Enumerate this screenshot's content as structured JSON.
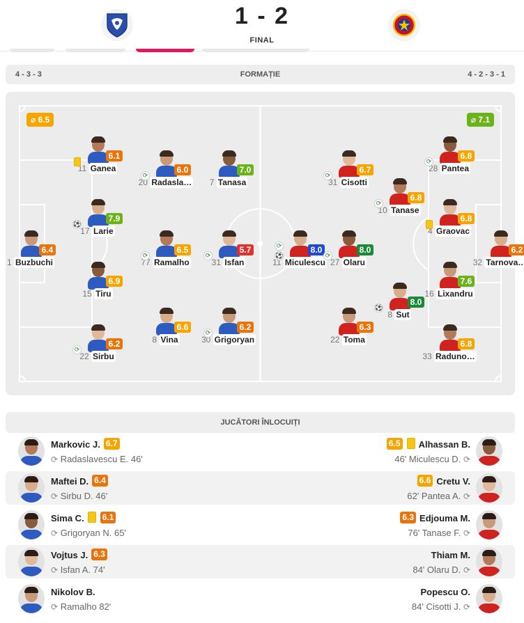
{
  "colors": {
    "rating_orange": "#e8750c",
    "rating_amber": "#f5a400",
    "rating_green": "#6cb21b",
    "rating_darkgreen": "#1a8a3a",
    "rating_red": "#e0322c",
    "rating_blue": "#1f4ad1",
    "home_shirt": "#2d5bbf",
    "away_shirt": "#d0231f"
  },
  "header": {
    "home_crest_icon": "farul-crest-icon",
    "away_crest_icon": "fcsb-crest-icon",
    "score": "1 - 2",
    "status": "FINAL"
  },
  "formation_bar": {
    "home_formation": "4 - 3 - 3",
    "title": "FORMAȚIE",
    "away_formation": "4 - 2 - 3 - 1"
  },
  "pitch": {
    "home_avg": "⌀ 6.5",
    "away_avg": "⌀ 7.1",
    "home_players": [
      {
        "no": "1",
        "name": "Buzbuchi",
        "rating": "6.4",
        "tier": "orange",
        "event": ""
      },
      {
        "no": "11",
        "name": "Ganea",
        "rating": "6.1",
        "tier": "orange",
        "event": "card"
      },
      {
        "no": "17",
        "name": "Larie",
        "rating": "7.9",
        "tier": "green",
        "event": "ball"
      },
      {
        "no": "15",
        "name": "Tiru",
        "rating": "6.9",
        "tier": "amber",
        "event": ""
      },
      {
        "no": "22",
        "name": "Sirbu",
        "rating": "6.2",
        "tier": "orange",
        "event": "sub"
      },
      {
        "no": "20",
        "name": "Radasla…",
        "rating": "6.0",
        "tier": "orange",
        "event": "sub"
      },
      {
        "no": "77",
        "name": "Ramalho",
        "rating": "6.5",
        "tier": "amber",
        "event": "sub"
      },
      {
        "no": "8",
        "name": "Vina",
        "rating": "6.6",
        "tier": "amber",
        "event": ""
      },
      {
        "no": "7",
        "name": "Tanasa",
        "rating": "7.0",
        "tier": "green",
        "event": ""
      },
      {
        "no": "31",
        "name": "Isfan",
        "rating": "5.7",
        "tier": "red",
        "event": "sub"
      },
      {
        "no": "30",
        "name": "Grigoryan",
        "rating": "6.2",
        "tier": "orange",
        "event": "sub"
      }
    ],
    "away_players": [
      {
        "no": "11",
        "name": "Miculescu",
        "rating": "8.0",
        "tier": "blue",
        "event": "ball-sub"
      },
      {
        "no": "27",
        "name": "Olaru",
        "rating": "8.0",
        "tier": "darkgreen",
        "event": "sub"
      },
      {
        "no": "31",
        "name": "Cisotti",
        "rating": "6.7",
        "tier": "amber",
        "event": "sub"
      },
      {
        "no": "22",
        "name": "Toma",
        "rating": "6.3",
        "tier": "orange",
        "event": ""
      },
      {
        "no": "10",
        "name": "Tanase",
        "rating": "6.8",
        "tier": "amber",
        "event": "sub"
      },
      {
        "no": "8",
        "name": "Sut",
        "rating": "8.0",
        "tier": "darkgreen",
        "event": "ball"
      },
      {
        "no": "28",
        "name": "Pantea",
        "rating": "6.8",
        "tier": "amber",
        "event": "sub"
      },
      {
        "no": "4",
        "name": "Graovac",
        "rating": "6.8",
        "tier": "amber",
        "event": "card"
      },
      {
        "no": "16",
        "name": "Lixandru",
        "rating": "7.6",
        "tier": "green",
        "event": ""
      },
      {
        "no": "33",
        "name": "Raduno…",
        "rating": "6.8",
        "tier": "amber",
        "event": ""
      },
      {
        "no": "32",
        "name": "Tarnova…",
        "rating": "6.2",
        "tier": "orange",
        "event": ""
      }
    ]
  },
  "substitutes": {
    "title": "JUCĂTORI ÎNLOCUIȚI",
    "rows": [
      {
        "home_name": "Markovic J.",
        "home_rating": "6.7",
        "home_tier": "amber",
        "home_card": false,
        "home_detail": "Radaslavescu E. 46'",
        "away_name": "Alhassan B.",
        "away_rating": "6.5",
        "away_tier": "amber",
        "away_card": true,
        "away_detail": "46' Miculescu D."
      },
      {
        "home_name": "Maftei D.",
        "home_rating": "6.4",
        "home_tier": "orange",
        "home_card": false,
        "home_detail": "Sirbu D. 46'",
        "away_name": "Cretu V.",
        "away_rating": "6.6",
        "away_tier": "amber",
        "away_card": false,
        "away_detail": "62' Pantea A."
      },
      {
        "home_name": "Sima C.",
        "home_rating": "6.1",
        "home_tier": "orange",
        "home_card": true,
        "home_detail": "Grigoryan N. 65'",
        "away_name": "Edjouma M.",
        "away_rating": "6.3",
        "away_tier": "orange",
        "away_card": false,
        "away_detail": "76' Tanase F."
      },
      {
        "home_name": "Vojtus J.",
        "home_rating": "6.3",
        "home_tier": "orange",
        "home_card": false,
        "home_detail": "Isfan A. 74'",
        "away_name": "Thiam M.",
        "away_rating": "",
        "away_tier": "",
        "away_card": false,
        "away_detail": "84' Olaru D."
      },
      {
        "home_name": "Nikolov B.",
        "home_rating": "",
        "home_tier": "",
        "home_card": false,
        "home_detail": "Ramalho 82'",
        "away_name": "Popescu O.",
        "away_rating": "",
        "away_tier": "",
        "away_card": false,
        "away_detail": "84' Cisotti J."
      }
    ]
  }
}
